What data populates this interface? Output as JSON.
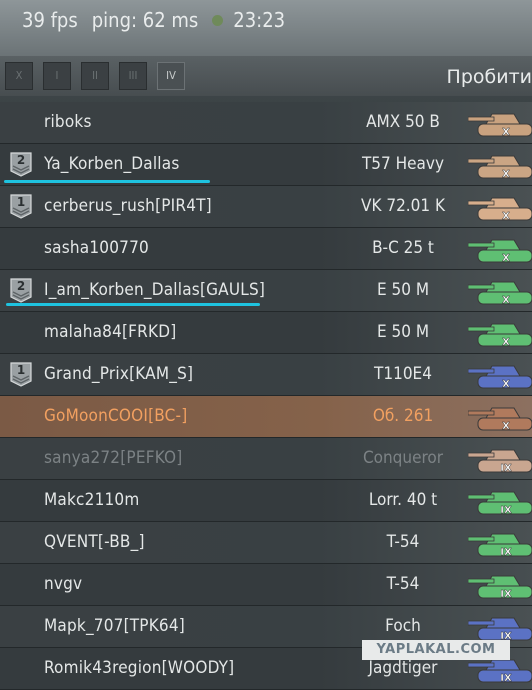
{
  "status": {
    "fps": "39 fps",
    "ping": "ping: 62 ms",
    "time": "23:23"
  },
  "filters": [
    "X",
    "I",
    "II",
    "III",
    "IV"
  ],
  "column_header": "Пробити",
  "rows": [
    {
      "name": "riboks",
      "tank": "AMX 50 B",
      "badge": "",
      "tank_color": "#c9a27f",
      "tier": "X",
      "state": "normal"
    },
    {
      "name": "Ya_Korben_Dallas",
      "tank": "T57 Heavy",
      "badge": "2",
      "tank_color": "#caa584",
      "tier": "X",
      "state": "normal"
    },
    {
      "name": "cerberus_rush[PIR4T]",
      "tank": "VK 72.01 K",
      "badge": "1",
      "tank_color": "#d7ae8c",
      "tier": "X",
      "state": "normal"
    },
    {
      "name": "sasha100770",
      "tank": "B-C 25 t",
      "badge": "",
      "tank_color": "#5fbf73",
      "tier": "X",
      "state": "normal"
    },
    {
      "name": "I_am_Korben_Dallas[GAULS]",
      "tank": "E 50 M",
      "badge": "2",
      "tank_color": "#5fbf73",
      "tier": "X",
      "state": "normal"
    },
    {
      "name": "malaha84[FRKD]",
      "tank": "E 50 M",
      "badge": "",
      "tank_color": "#5fbf73",
      "tier": "X",
      "state": "normal"
    },
    {
      "name": "Grand_Prix[KAM_S]",
      "tank": "T110E4",
      "badge": "1",
      "tank_color": "#5b72c4",
      "tier": "X",
      "state": "normal"
    },
    {
      "name": "GoMoonCOOI[BC-]",
      "tank": "Об. 261",
      "badge": "",
      "tank_color": "#b07a5d",
      "tier": "X",
      "state": "self"
    },
    {
      "name": "sanya272[PEFKO]",
      "tank": "Conqueror",
      "badge": "",
      "tank_color": "#c9a690",
      "tier": "IX",
      "state": "dead"
    },
    {
      "name": "Makc2110m",
      "tank": "Lorr. 40 t",
      "badge": "",
      "tank_color": "#5fbf73",
      "tier": "IX",
      "state": "normal"
    },
    {
      "name": "QVENT[-BB_]",
      "tank": "T-54",
      "badge": "",
      "tank_color": "#5fbf73",
      "tier": "IX",
      "state": "normal"
    },
    {
      "name": "nvgv",
      "tank": "T-54",
      "badge": "",
      "tank_color": "#5fbf73",
      "tier": "IX",
      "state": "normal"
    },
    {
      "name": "Mapk_707[TPK64]",
      "tank": "Foch",
      "badge": "",
      "tank_color": "#5b72c4",
      "tier": "IX",
      "state": "normal"
    },
    {
      "name": "Romik43region[WOODY]",
      "tank": "Jagdtiger",
      "badge": "",
      "tank_color": "#5b72c4",
      "tier": "IX",
      "state": "normal"
    }
  ],
  "watermark": "YAPLAKAL.COM"
}
